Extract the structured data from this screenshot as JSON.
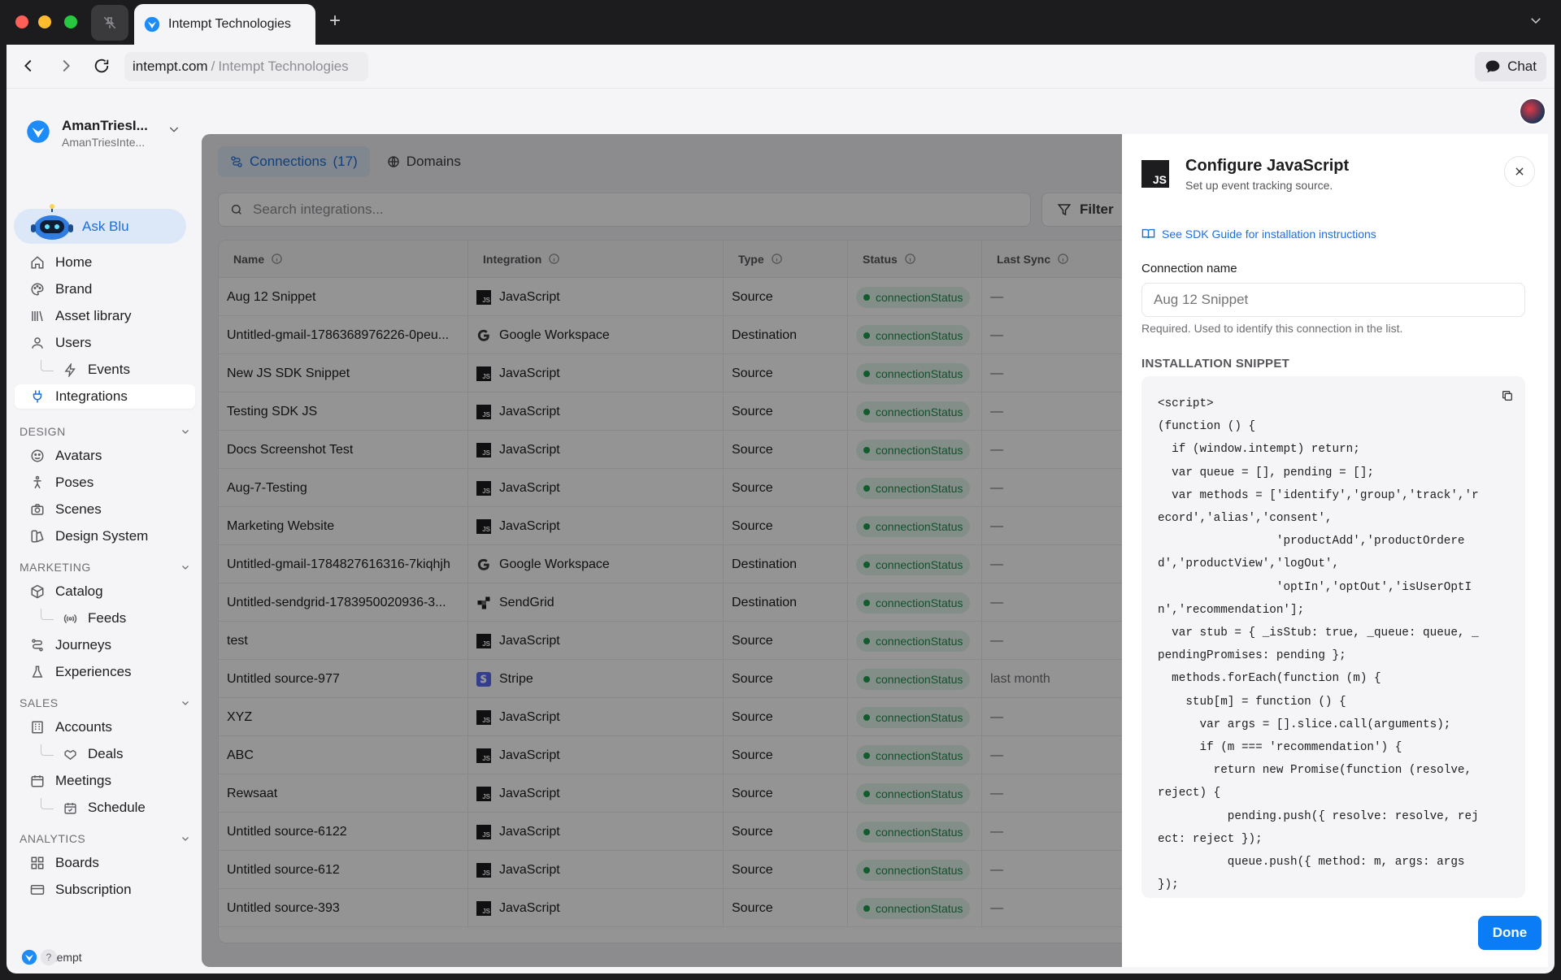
{
  "browser": {
    "tab_title": "Intempt Technologies",
    "url_domain": "intempt.com",
    "url_sep": "/",
    "url_title": "Intempt Technologies",
    "chat_label": "Chat"
  },
  "workspace": {
    "name": "AmanTriesI...",
    "sub": "AmanTriesInte..."
  },
  "ask_blu": "Ask Blu",
  "nav": {
    "home": "Home",
    "brand": "Brand",
    "asset_library": "Asset library",
    "users": "Users",
    "events": "Events",
    "integrations": "Integrations",
    "design_section": "DESIGN",
    "avatars": "Avatars",
    "poses": "Poses",
    "scenes": "Scenes",
    "design_system": "Design System",
    "marketing_section": "MARKETING",
    "catalog": "Catalog",
    "feeds": "Feeds",
    "journeys": "Journeys",
    "experiences": "Experiences",
    "sales_section": "SALES",
    "accounts": "Accounts",
    "deals": "Deals",
    "meetings": "Meetings",
    "schedule": "Schedule",
    "analytics_section": "ANALYTICS",
    "boards": "Boards",
    "subscription": "Subscription"
  },
  "footer": {
    "brand": "Intempt",
    "help": "?"
  },
  "page_tabs": {
    "connections": "Connections",
    "connections_count": "(17)",
    "domains": "Domains"
  },
  "search": {
    "placeholder": "Search integrations..."
  },
  "filter_label": "Filter",
  "table": {
    "headers": [
      "Name",
      "Integration",
      "Type",
      "Status",
      "Last Sync"
    ],
    "rows": [
      {
        "name": "Aug 12 Snippet",
        "integration": "JavaScript",
        "icon": "javascript",
        "type": "Source",
        "status": "connectionStatus",
        "last_sync": "—"
      },
      {
        "name": "Untitled-gmail-1786368976226-0peu...",
        "integration": "Google Workspace",
        "icon": "google",
        "type": "Destination",
        "status": "connectionStatus",
        "last_sync": "—"
      },
      {
        "name": "New JS SDK Snippet",
        "integration": "JavaScript",
        "icon": "javascript",
        "type": "Source",
        "status": "connectionStatus",
        "last_sync": "—"
      },
      {
        "name": "Testing SDK JS",
        "integration": "JavaScript",
        "icon": "javascript",
        "type": "Source",
        "status": "connectionStatus",
        "last_sync": "—"
      },
      {
        "name": "Docs Screenshot Test",
        "integration": "JavaScript",
        "icon": "javascript",
        "type": "Source",
        "status": "connectionStatus",
        "last_sync": "—"
      },
      {
        "name": "Aug-7-Testing",
        "integration": "JavaScript",
        "icon": "javascript",
        "type": "Source",
        "status": "connectionStatus",
        "last_sync": "—"
      },
      {
        "name": "Marketing Website",
        "integration": "JavaScript",
        "icon": "javascript",
        "type": "Source",
        "status": "connectionStatus",
        "last_sync": "—"
      },
      {
        "name": "Untitled-gmail-1784827616316-7kiqhjh",
        "integration": "Google Workspace",
        "icon": "google",
        "type": "Destination",
        "status": "connectionStatus",
        "last_sync": "—"
      },
      {
        "name": "Untitled-sendgrid-1783950020936-3...",
        "integration": "SendGrid",
        "icon": "sendgrid",
        "type": "Destination",
        "status": "connectionStatus",
        "last_sync": "—"
      },
      {
        "name": "test",
        "integration": "JavaScript",
        "icon": "javascript",
        "type": "Source",
        "status": "connectionStatus",
        "last_sync": "—"
      },
      {
        "name": "Untitled source-977",
        "integration": "Stripe",
        "icon": "stripe",
        "type": "Source",
        "status": "connectionStatus",
        "last_sync": "last month"
      },
      {
        "name": "XYZ",
        "integration": "JavaScript",
        "icon": "javascript",
        "type": "Source",
        "status": "connectionStatus",
        "last_sync": "—"
      },
      {
        "name": "ABC",
        "integration": "JavaScript",
        "icon": "javascript",
        "type": "Source",
        "status": "connectionStatus",
        "last_sync": "—"
      },
      {
        "name": "Rewsaat",
        "integration": "JavaScript",
        "icon": "javascript",
        "type": "Source",
        "status": "connectionStatus",
        "last_sync": "—"
      },
      {
        "name": "Untitled source-6122",
        "integration": "JavaScript",
        "icon": "javascript",
        "type": "Source",
        "status": "connectionStatus",
        "last_sync": "—"
      },
      {
        "name": "Untitled source-612",
        "integration": "JavaScript",
        "icon": "javascript",
        "type": "Source",
        "status": "connectionStatus",
        "last_sync": "—"
      },
      {
        "name": "Untitled source-393",
        "integration": "JavaScript",
        "icon": "javascript",
        "type": "Source",
        "status": "connectionStatus",
        "last_sync": "—"
      }
    ]
  },
  "panel": {
    "icon_text": "JS",
    "title": "Configure JavaScript",
    "subtitle": "Set up event tracking source.",
    "sdk_link": "See SDK Guide for installation instructions",
    "conn_label": "Connection name",
    "conn_placeholder": "Aug 12 Snippet",
    "conn_help": "Required. Used to identify this connection in the list.",
    "snippet_label": "INSTALLATION SNIPPET",
    "snippet": "<script>\n(function () {\n  if (window.intempt) return;\n  var queue = [], pending = [];\n  var methods = ['identify','group','track','record','alias','consent',\n                 'productAdd','productOrdered','productView','logOut',\n                 'optIn','optOut','isUserOptIn','recommendation'];\n  var stub = { _isStub: true, _queue: queue, _pendingPromises: pending };\n  methods.forEach(function (m) {\n    stub[m] = function () {\n      var args = [].slice.call(arguments);\n      if (m === 'recommendation') {\n        return new Promise(function (resolve, reject) {\n          pending.push({ resolve: resolve, reject: reject });\n          queue.push({ method: m, args: args });",
    "done_label": "Done"
  },
  "colors": {
    "accent": "#0a7cf5",
    "status_green": "#1e8e4c",
    "active_tab_bg": "#dce8f7"
  }
}
